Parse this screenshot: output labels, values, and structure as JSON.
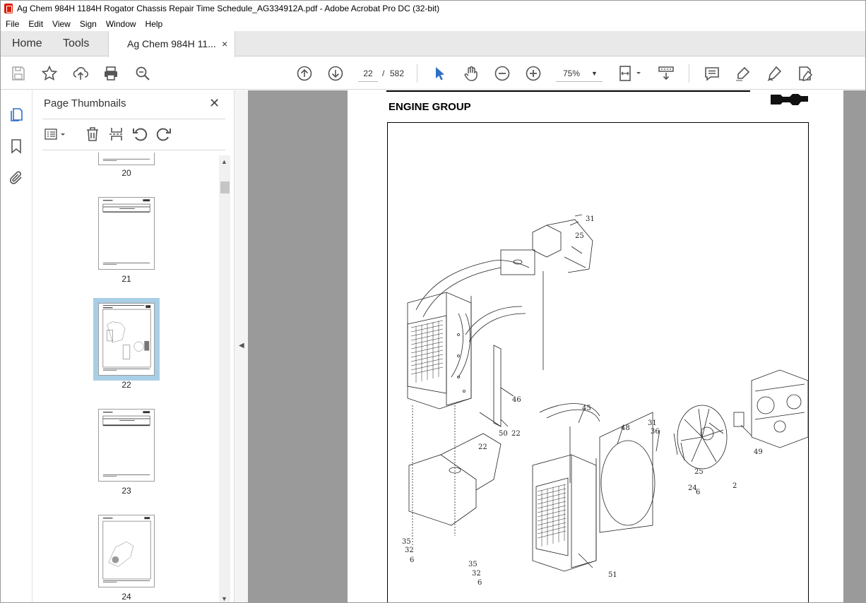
{
  "window": {
    "title": "Ag Chem 984H 1184H Rogator Chassis Repair Time Schedule_AG334912A.pdf - Adobe Acrobat Pro DC (32-bit)"
  },
  "menu": [
    "File",
    "Edit",
    "View",
    "Sign",
    "Window",
    "Help"
  ],
  "tabs": {
    "home": "Home",
    "tools": "Tools",
    "document": "Ag Chem 984H 11...",
    "close": "×"
  },
  "toolbar": {
    "page_current": "22",
    "page_sep": "/",
    "page_total": "582",
    "zoom": "75%"
  },
  "thumbnail_panel": {
    "title": "Page Thumbnails",
    "close": "✕",
    "thumbnails": [
      {
        "label": "20",
        "selected": false
      },
      {
        "label": "21",
        "selected": false
      },
      {
        "label": "22",
        "selected": true
      },
      {
        "label": "23",
        "selected": false
      },
      {
        "label": "24",
        "selected": false
      }
    ]
  },
  "document": {
    "heading": "ENGINE GROUP",
    "callouts": [
      "31",
      "25",
      "46",
      "50",
      "22",
      "22",
      "45",
      "48",
      "31",
      "36",
      "49",
      "25",
      "24",
      "6",
      "2",
      "35",
      "32",
      "6",
      "35",
      "32",
      "6",
      "51"
    ]
  }
}
